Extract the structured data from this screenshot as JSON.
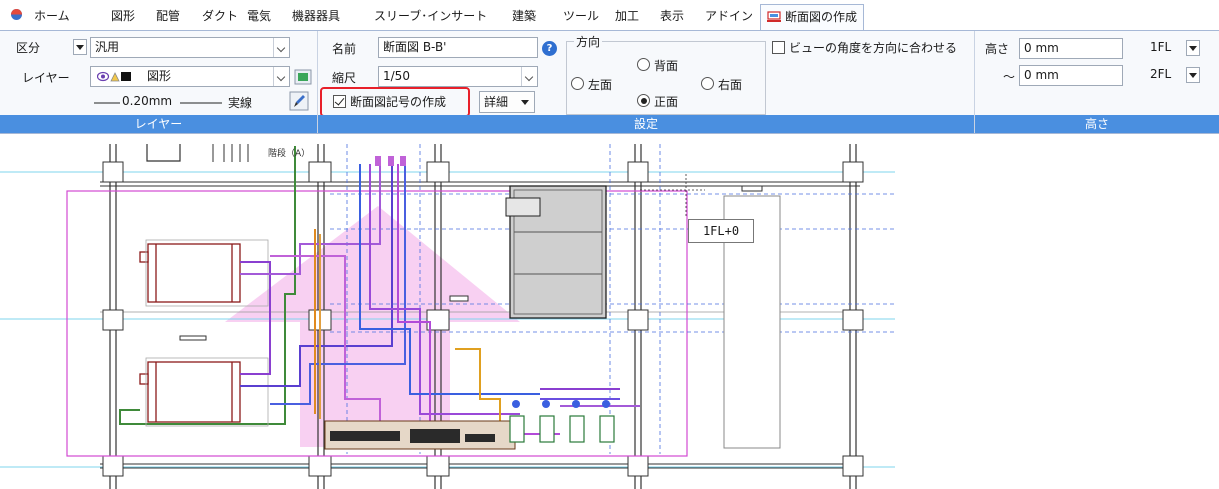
{
  "menu": {
    "items": [
      "ホーム",
      "図形",
      "配管",
      "ダクト",
      "電気",
      "機器器具",
      "スリーブ･インサート",
      "建築",
      "ツール",
      "加工",
      "表示",
      "アドイン"
    ],
    "active_tab": "断面図の作成"
  },
  "layer_section": {
    "classification_label": "区分",
    "classification_value": "汎用",
    "layer_label": "レイヤー",
    "layer_value": "図形",
    "line_weight": "0.20mm",
    "line_type": "実線",
    "footer": "レイヤー"
  },
  "settings_section": {
    "name_label": "名前",
    "name_value": "断面図 B-B'",
    "scale_label": "縮尺",
    "scale_value": "1/50",
    "create_symbol_label": "断面図記号の作成",
    "create_symbol_checked": true,
    "detail_button": "詳細",
    "direction_title": "方向",
    "dir_left": "左面",
    "dir_back": "背面",
    "dir_front": "正面",
    "dir_right": "右面",
    "selected_direction": "正面",
    "align_view_label": "ビューの角度を方向に合わせる",
    "footer": "設定"
  },
  "height_section": {
    "height_label": "高さ",
    "range_label": "～",
    "from_value": "0 mm",
    "from_level": "1FL",
    "to_value": "0 mm",
    "to_level": "2FL",
    "footer": "高さ"
  },
  "canvas": {
    "stair_label": "階段（A）",
    "level_tag": "1FL+0"
  },
  "colors": {
    "ribbon_footer": "#4a8fe0",
    "highlight": "#e8202a",
    "grid_line": "#7fd4ee",
    "section_outline": "#d24ad2"
  }
}
